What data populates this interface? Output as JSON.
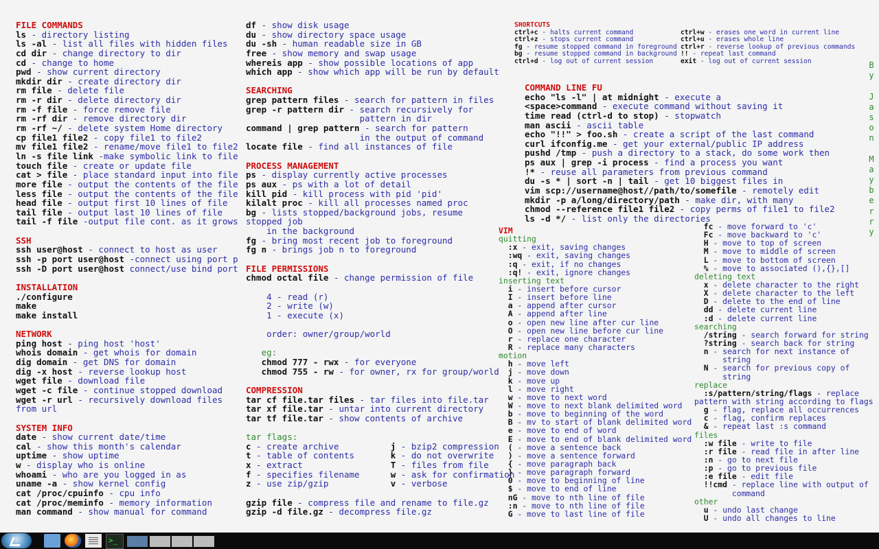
{
  "col1": [
    [
      "sec",
      "FILE COMMANDS"
    ],
    [
      "ls",
      " - directory listing"
    ],
    [
      "ls -al",
      " - list all files with hidden files"
    ],
    [
      "cd dir",
      " - change directory to dir"
    ],
    [
      "cd",
      " - change to home"
    ],
    [
      "pwd",
      " - show current directory"
    ],
    [
      "mkdir dir",
      " - create directory dir"
    ],
    [
      "rm file",
      " - delete file"
    ],
    [
      "rm -r dir",
      " - delete directory dir"
    ],
    [
      "rm -f file",
      " - force remove file"
    ],
    [
      "rm -rf dir",
      " - remove directory dir"
    ],
    [
      "rm -rf ~/",
      " - delete system Home directory"
    ],
    [
      "cp file1 file2",
      " - copy file1 to file2"
    ],
    [
      "mv file1 file2",
      " - rename/move file1 to file2"
    ],
    [
      "ln -s file link",
      " -make symbolic link to file"
    ],
    [
      "touch file",
      " - create or update file"
    ],
    [
      "cat > file",
      " - place standard input into file"
    ],
    [
      "more file",
      " - output the contents of the file"
    ],
    [
      "less file",
      " - output the contents of the file"
    ],
    [
      "head file",
      " - output first 10 lines of file"
    ],
    [
      "tail file",
      " - output last 10 lines of file"
    ],
    [
      "tail -f file",
      " -output file cont. as it grows"
    ],
    [
      "gap"
    ],
    [
      "sec",
      "SSH"
    ],
    [
      "ssh user@host",
      " - connect to host as user"
    ],
    [
      "ssh -p port user@host",
      " -connect using port p"
    ],
    [
      "ssh -D port user@host",
      " connect/use bind port"
    ],
    [
      "gap"
    ],
    [
      "sec",
      "INSTALLATION"
    ],
    [
      "./configure",
      ""
    ],
    [
      "make",
      ""
    ],
    [
      "make install",
      ""
    ],
    [
      "gap"
    ],
    [
      "sec",
      "NETWORK"
    ],
    [
      "ping host",
      " - ping host 'host'"
    ],
    [
      "whois domain",
      " - get whois for domain"
    ],
    [
      "dig domain",
      " - get DNS for domain"
    ],
    [
      "dig -x host",
      " - reverse lookup host"
    ],
    [
      "wget file",
      " - download file"
    ],
    [
      "wget -c file",
      " - continue stopped download"
    ],
    [
      "wget -r url",
      " - recursively download files"
    ],
    [
      "",
      "from url"
    ],
    [
      "gap"
    ],
    [
      "sec",
      "SYSTEM INFO"
    ],
    [
      "date",
      " - show current date/time"
    ],
    [
      "cal",
      " - show this month's calendar"
    ],
    [
      "uptime",
      " - show uptime"
    ],
    [
      "w",
      " - display who is online"
    ],
    [
      "whoami",
      " - who are you logged in as"
    ],
    [
      "uname -a",
      " - show kernel config"
    ],
    [
      "cat /proc/cpuinfo",
      " - cpu info"
    ],
    [
      "cat /proc/meminfo",
      " - memory information"
    ],
    [
      "man command",
      " - show manual for command"
    ]
  ],
  "col2": [
    [
      "df",
      " - show disk usage"
    ],
    [
      "du",
      " - show directory space usage"
    ],
    [
      "du -sh",
      " - human readable size in GB"
    ],
    [
      "free",
      " - show memory and swap usage"
    ],
    [
      "whereis app",
      " - show possible locations of app"
    ],
    [
      "which app",
      " - show which app will be run by default"
    ],
    [
      "gap"
    ],
    [
      "sec",
      "SEARCHING"
    ],
    [
      "grep pattern files",
      " - search for pattern in files"
    ],
    [
      "grep -r pattern dir",
      " - search recursively for"
    ],
    [
      "",
      "                      pattern in dir"
    ],
    [
      "command | grep pattern",
      " - search for pattern"
    ],
    [
      "",
      "                      in the output of command"
    ],
    [
      "locate file",
      " - find all instances of file"
    ],
    [
      "gap"
    ],
    [
      "sec",
      "PROCESS MANAGEMENT"
    ],
    [
      "ps",
      " - display currently active processes"
    ],
    [
      "ps aux",
      " - ps with a lot of detail"
    ],
    [
      "kill pid",
      " - kill process with pid 'pid'"
    ],
    [
      "kilalt proc",
      " - kill all processes named proc"
    ],
    [
      "bg",
      " - lists stopped/background jobs, resume"
    ],
    [
      "",
      "stopped job"
    ],
    [
      "",
      "    in the background"
    ],
    [
      "fg",
      " - bring most recent job to foreground"
    ],
    [
      "fg n",
      " - brings job n to foreground"
    ],
    [
      "gap"
    ],
    [
      "sec",
      "FILE PERMISSIONS"
    ],
    [
      "chmod octal file",
      " - change permission of file"
    ],
    [
      "gap"
    ],
    [
      "",
      "    4 - read (r)"
    ],
    [
      "",
      "    2 - write (w)"
    ],
    [
      "",
      "    1 - execute (x)"
    ],
    [
      "gap"
    ],
    [
      "",
      "    order: owner/group/world"
    ],
    [
      "gap"
    ],
    [
      "sub",
      "   eg:"
    ],
    [
      "   chmod 777 - rwx",
      " - for everyone"
    ],
    [
      "   chmod 755 - rw",
      " - for owner, rx for group/world"
    ],
    [
      "gap"
    ],
    [
      "sec",
      "COMPRESSION"
    ],
    [
      "tar cf file.tar files",
      " - tar files into file.tar"
    ],
    [
      "tar xf file.tar",
      " - untar into current directory"
    ],
    [
      "tar tf file.tar",
      " - show contents of archive"
    ],
    [
      "gap"
    ],
    [
      "sub",
      "tar flags:"
    ],
    [
      "c",
      " - create archive          ",
      "j",
      " - bzip2 compression"
    ],
    [
      "t",
      " - table of contents       ",
      "k",
      " - do not overwrite"
    ],
    [
      "x",
      " - extract                 ",
      "T",
      " - files from file"
    ],
    [
      "f",
      " - specifies filename      ",
      "w",
      " - ask for confirmation"
    ],
    [
      "z",
      " - use zip/gzip            ",
      "v",
      " - verbose"
    ],
    [
      "gap"
    ],
    [
      "gzip file",
      " - compress file and rename to file.gz"
    ],
    [
      "gzip -d file.gz",
      " - decompress file.gz"
    ]
  ],
  "shortcuts_left": [
    [
      "sec",
      "SHORTCUTS"
    ],
    [
      "ctrl+c",
      " - halts current command"
    ],
    [
      "ctrl+z",
      " - stops current command"
    ],
    [
      "fg",
      " - resume stopped command in foreground"
    ],
    [
      "bg",
      " - resume stopped command in background"
    ],
    [
      "ctrl+d",
      " - log out of current session"
    ]
  ],
  "shortcuts_right": [
    [
      "gap"
    ],
    [
      "ctrl+w",
      " - erases one word in current line"
    ],
    [
      "ctrl+u",
      " - erases whole line"
    ],
    [
      "ctrl+r",
      " - reverse lookup of previous commands"
    ],
    [
      "!!",
      " - repeat last command"
    ],
    [
      "exit",
      " - log out of current session"
    ]
  ],
  "cmdfu": [
    [
      "sec",
      "COMMAND LINE FU"
    ],
    [
      "echo \"ls -l\" | at midnight",
      " - execute a"
    ],
    [
      "<space>command",
      " - execute command without saving it"
    ],
    [
      "time read (ctrl-d to stop)",
      " - stopwatch"
    ],
    [
      "man ascii",
      " - ascii table"
    ],
    [
      "echo \"!!\" > foo.sh",
      " - create a script of the last command"
    ],
    [
      "curl ifconfig.me",
      " - get your external/public IP address"
    ],
    [
      "pushd /tmp",
      " - push a directory to a stack, do some work then"
    ],
    [
      "ps aux | grep -i process",
      " - find a process you want"
    ],
    [
      "!*",
      " - reuse all parameters from previous command"
    ],
    [
      "du -s * | sort -n | tail",
      " - get 10 biggest files in"
    ],
    [
      "vim scp://username@host//path/to/somefile",
      " - remotely edit"
    ],
    [
      "mkdir -p a/long/directory/path",
      " - make dir, with many"
    ],
    [
      "chmod --reference file1 file2",
      " - copy perms of file1 to file2"
    ],
    [
      "ls -d */",
      " - list only the directories"
    ]
  ],
  "vim_left": [
    [
      "sec",
      "VIM"
    ],
    [
      "sub",
      "quitting"
    ],
    [
      "  :x",
      " - exit, saving changes"
    ],
    [
      "  :wq",
      " - exit, saving changes"
    ],
    [
      "  :q",
      " - exit, if no changes"
    ],
    [
      "  :q!",
      " - exit, ignore changes"
    ],
    [
      "sub",
      "inserting text"
    ],
    [
      "  i",
      " - insert before cursor"
    ],
    [
      "  I",
      " - insert before line"
    ],
    [
      "  a",
      " - append after cursor"
    ],
    [
      "  A",
      " - append after line"
    ],
    [
      "  o",
      " - open new line after cur line"
    ],
    [
      "  O",
      " - open new line before cur line"
    ],
    [
      "  r",
      " - replace one character"
    ],
    [
      "  R",
      " - replace many characters"
    ],
    [
      "sub",
      "motion"
    ],
    [
      "  h",
      " - move left"
    ],
    [
      "  j",
      " - move down"
    ],
    [
      "  k",
      " - move up"
    ],
    [
      "  l",
      " - move right"
    ],
    [
      "  w",
      " - move to next word"
    ],
    [
      "  W",
      " - move to next blank delimited word"
    ],
    [
      "  b",
      " - move to beginning of the word"
    ],
    [
      "  B",
      " - mv to start of blank delimited word"
    ],
    [
      "  e",
      " - move to end of word"
    ],
    [
      "  E",
      " - move to end of blank delimited word"
    ],
    [
      "  (",
      " - move a sentence back"
    ],
    [
      "  )",
      " - move a sentence forward"
    ],
    [
      "  {",
      " - move paragraph back"
    ],
    [
      "  }",
      " - move paragraph forward"
    ],
    [
      "  0",
      " - move to beginning of line"
    ],
    [
      "  $",
      " - move to end of line"
    ],
    [
      "  nG",
      " - move to nth line of file"
    ],
    [
      "  :n",
      " - move to nth line of file"
    ],
    [
      "  G",
      " - move to last line of file"
    ]
  ],
  "vim_right": [
    [
      "  fc",
      " - move forward to 'c'"
    ],
    [
      "  Fc",
      " - move backward to 'c'"
    ],
    [
      "  H",
      " - move to top of screen"
    ],
    [
      "  M",
      " - move to middle of screen"
    ],
    [
      "  L",
      " - move to bottom of screen"
    ],
    [
      "  %",
      " - move to associated (),{},[]"
    ],
    [
      "sub",
      "deleting text"
    ],
    [
      "  x",
      " - delete character to the right"
    ],
    [
      "  X",
      " - delete character to the left"
    ],
    [
      "  D",
      " - delete to the end of line"
    ],
    [
      "  dd",
      " - delete current line"
    ],
    [
      "  :d",
      " - delete current line"
    ],
    [
      "sub",
      "searching"
    ],
    [
      "  /string",
      " - search forward for string"
    ],
    [
      "  ?string",
      " - search back for string"
    ],
    [
      "  n",
      " - search for next instance of"
    ],
    [
      "",
      "      string"
    ],
    [
      "  N",
      " - search for previous copy of"
    ],
    [
      "",
      "      string"
    ],
    [
      "sub",
      "replace"
    ],
    [
      "  :s/pattern/string/flags",
      " - replace"
    ],
    [
      "",
      "pattern with string according to flags"
    ],
    [
      "  g",
      " - flag, replace all occurrences"
    ],
    [
      "  c",
      " - flag, confirm replaces"
    ],
    [
      "  &",
      " - repeat last :s command"
    ],
    [
      "sub",
      "files"
    ],
    [
      "  :w file",
      " - write to file"
    ],
    [
      "  :r file",
      " - read file in after line"
    ],
    [
      "  :n",
      " - go to next file"
    ],
    [
      "  :p",
      " - go to previous file"
    ],
    [
      "  :e file",
      " - edit file"
    ],
    [
      "  !!cmd",
      " - replace line with output of"
    ],
    [
      "",
      "        command"
    ],
    [
      "sub",
      "other"
    ],
    [
      "  u",
      " - undo last change"
    ],
    [
      "  U",
      " - undo all changes to line"
    ]
  ],
  "byline": [
    "B",
    "y",
    "",
    "J",
    "a",
    "s",
    "o",
    "n",
    "",
    "M",
    "a",
    "y",
    "b",
    "e",
    "r",
    "r",
    "y"
  ],
  "taskbar": {
    "icons": [
      "start-orb-icon",
      "file-manager-icon",
      "firefox-icon",
      "text-editor-icon",
      "terminal-icon"
    ]
  }
}
